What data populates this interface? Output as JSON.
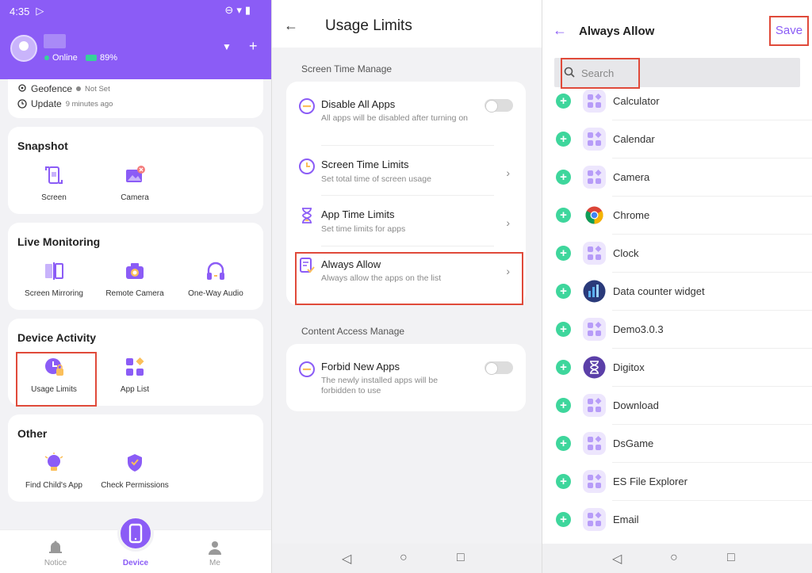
{
  "left_panel": {
    "status": {
      "time": "4:35",
      "battery_pct": "89%"
    },
    "device": {
      "status": "Online"
    },
    "location": {
      "geofence_label": "Geofence",
      "geofence_value": "Not Set",
      "update_label": "Update",
      "update_value": "9 minutes ago"
    },
    "sections": {
      "snapshot": {
        "title": "Snapshot",
        "items": [
          "Screen",
          "Camera"
        ]
      },
      "live": {
        "title": "Live Monitoring",
        "items": [
          "Screen Mirroring",
          "Remote Camera",
          "One-Way Audio"
        ]
      },
      "activity": {
        "title": "Device Activity",
        "items": [
          "Usage Limits",
          "App List"
        ]
      },
      "other": {
        "title": "Other",
        "items": [
          "Find Child's App",
          "Check Permissions"
        ]
      }
    },
    "bottom_nav": [
      "Notice",
      "Device",
      "Me"
    ]
  },
  "middle_panel": {
    "title": "Usage Limits",
    "section1": "Screen Time Manage",
    "section2": "Content Access Manage",
    "settings": [
      {
        "title": "Disable All Apps",
        "subtitle": "All apps will be disabled after turning on",
        "toggle": false
      },
      {
        "title": "Screen Time Limits",
        "subtitle": "Set total time of screen usage"
      },
      {
        "title": "App Time Limits",
        "subtitle": "Set time limits for apps"
      },
      {
        "title": "Always Allow",
        "subtitle": "Always allow the apps on the list"
      },
      {
        "title": "Forbid New Apps",
        "subtitle": "The newly installed apps will be forbidden to use",
        "toggle": false
      }
    ]
  },
  "right_panel": {
    "title": "Always Allow",
    "save_label": "Save",
    "search_placeholder": "Search",
    "apps": [
      "Calculator",
      "Calendar",
      "Camera",
      "Chrome",
      "Clock",
      "Data counter widget",
      "Demo3.0.3",
      "Digitox",
      "Download",
      "DsGame",
      "ES File Explorer",
      "Email"
    ]
  },
  "colors": {
    "accent": "#8b5cf6",
    "highlight": "#e04a3a",
    "add_green": "#3ed69c"
  }
}
